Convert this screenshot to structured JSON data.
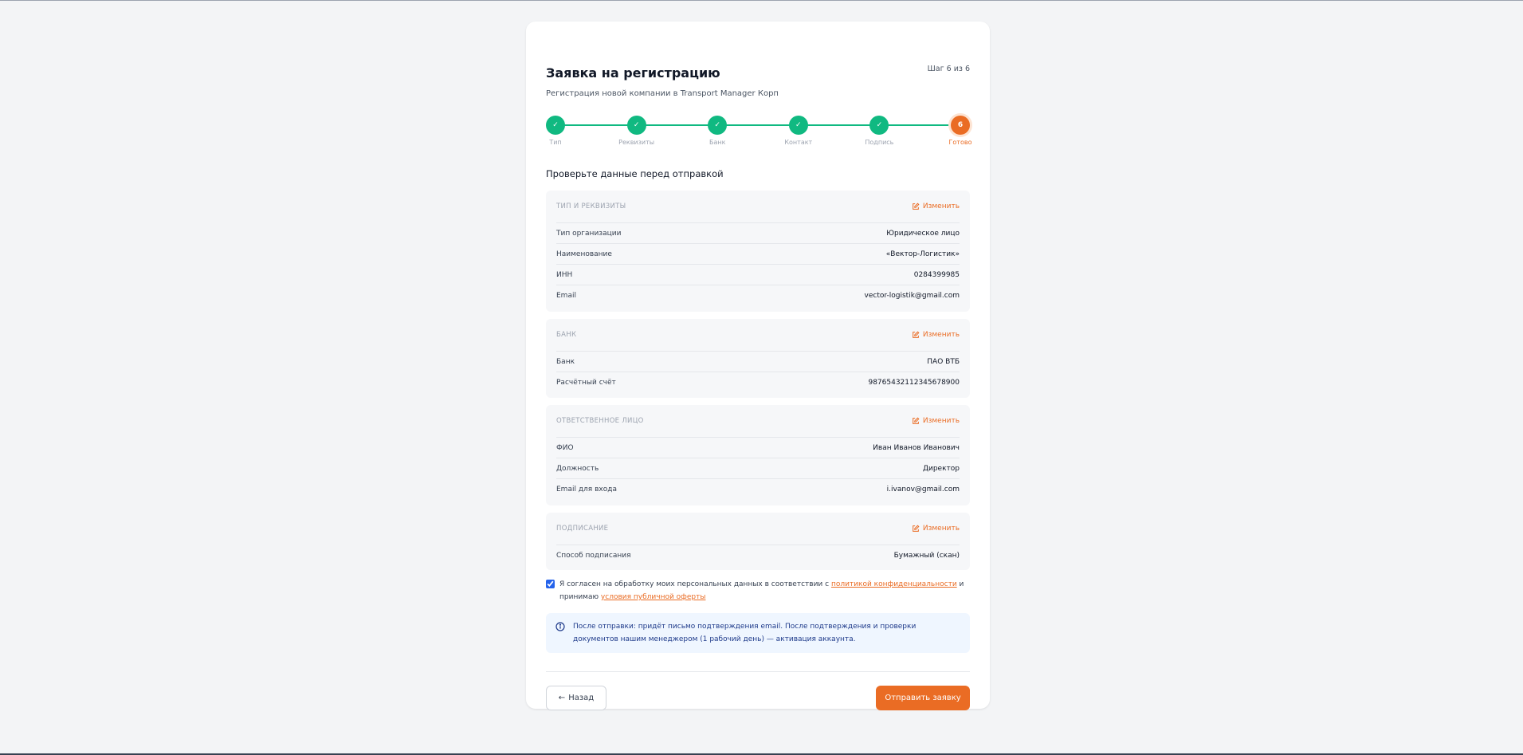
{
  "header": {
    "title": "Заявка на регистрацию",
    "subtitle": "Регистрация новой компании в Transport Manager Корп",
    "step_counter": "Шаг 6 из 6"
  },
  "stepper": {
    "steps": [
      {
        "label": "Тип",
        "state": "done"
      },
      {
        "label": "Реквизиты",
        "state": "done"
      },
      {
        "label": "Банк",
        "state": "done"
      },
      {
        "label": "Контакт",
        "state": "done"
      },
      {
        "label": "Подпись",
        "state": "done"
      },
      {
        "label": "Готово",
        "state": "active",
        "number": "6"
      }
    ]
  },
  "review_heading": "Проверьте данные перед отправкой",
  "sections": [
    {
      "title": "ТИП И РЕКВИЗИТЫ",
      "edit_label": "Изменить",
      "rows": [
        {
          "label": "Тип организации",
          "value": "Юридическое лицо"
        },
        {
          "label": "Наименование",
          "value": "«Вектор-Логистик»"
        },
        {
          "label": "ИНН",
          "value": "0284399985"
        },
        {
          "label": "Email",
          "value": "vector-logistik@gmail.com"
        }
      ]
    },
    {
      "title": "БАНК",
      "edit_label": "Изменить",
      "rows": [
        {
          "label": "Банк",
          "value": "ПАО ВТБ"
        },
        {
          "label": "Расчётный счёт",
          "value": "98765432112345678900"
        }
      ]
    },
    {
      "title": "ОТВЕТСТВЕННОЕ ЛИЦО",
      "edit_label": "Изменить",
      "rows": [
        {
          "label": "ФИО",
          "value": "Иван Иванов Иванович"
        },
        {
          "label": "Должность",
          "value": "Директор"
        },
        {
          "label": "Email для входа",
          "value": "i.ivanov@gmail.com"
        }
      ]
    },
    {
      "title": "ПОДПИСАНИЕ",
      "edit_label": "Изменить",
      "rows": [
        {
          "label": "Способ подписания",
          "value": "Бумажный (скан)"
        }
      ]
    }
  ],
  "consent": {
    "checked": true,
    "text_before": "Я согласен на обработку моих персональных данных в соответствии с ",
    "privacy_link": "политикой конфиденциальности",
    "text_middle": " и принимаю ",
    "offer_link": "условия публичной оферты"
  },
  "info": {
    "text": "После отправки: придёт письмо подтверждения email. После подтверждения и проверки документов нашим менеджером (1 рабочий день) — активация аккаунта."
  },
  "footer": {
    "back_label": "Назад",
    "submit_label": "Отправить заявку"
  },
  "colors": {
    "accent": "#ea6c24",
    "success": "#10b981",
    "info_bg": "#eff6ff",
    "info_text": "#1e3a8a"
  }
}
